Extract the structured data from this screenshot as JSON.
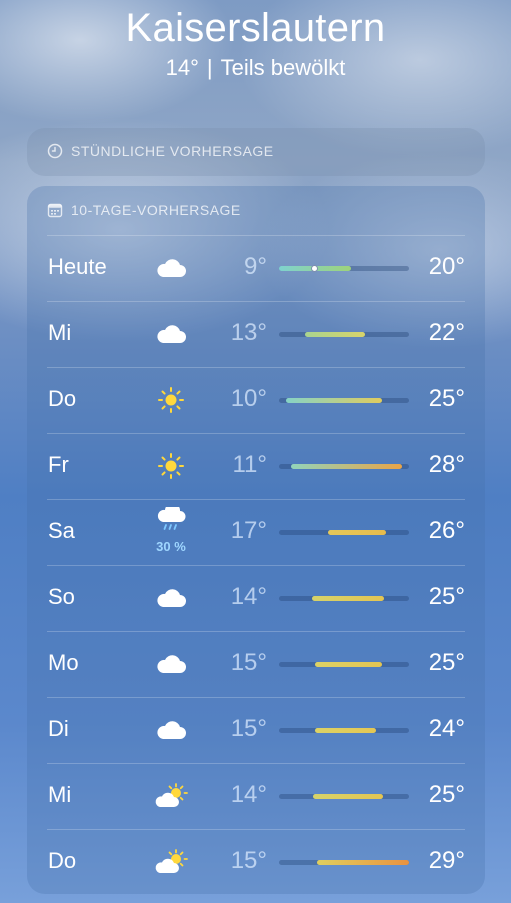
{
  "header": {
    "city": "Kaiserslautern",
    "current_temp": "14°",
    "separator": "|",
    "condition": "Teils bewölkt"
  },
  "hourly": {
    "label": "STÜNDLICHE VORHERSAGE",
    "icon": "clock-icon"
  },
  "daily": {
    "label": "10-TAGE-VORHERSAGE",
    "icon": "calendar-icon",
    "days": [
      {
        "day": "Heute",
        "icon": "cloud-icon",
        "low": "9°",
        "high": "20°",
        "bar_start": 0.0,
        "bar_end": 0.55,
        "current_marker": 0.27,
        "colors": [
          "#7fd2cf",
          "#9ed37a"
        ]
      },
      {
        "day": "Mi",
        "icon": "cloud-icon",
        "low": "13°",
        "high": "22°",
        "bar_start": 0.2,
        "bar_end": 0.66,
        "colors": [
          "#a9d48f",
          "#d8d46a"
        ]
      },
      {
        "day": "Do",
        "icon": "sun-icon",
        "low": "10°",
        "high": "25°",
        "bar_start": 0.05,
        "bar_end": 0.79,
        "colors": [
          "#86d3c6",
          "#e0cc5e"
        ]
      },
      {
        "day": "Fr",
        "icon": "sun-icon",
        "low": "11°",
        "high": "28°",
        "bar_start": 0.09,
        "bar_end": 0.95,
        "colors": [
          "#92d4bb",
          "#e9a447"
        ]
      },
      {
        "day": "Sa",
        "icon": "cloud-rain-icon",
        "precip": "30 %",
        "low": "17°",
        "high": "26°",
        "bar_start": 0.38,
        "bar_end": 0.82,
        "colors": [
          "#e5c85a",
          "#e6bb4d"
        ]
      },
      {
        "day": "So",
        "icon": "cloud-icon",
        "low": "14°",
        "high": "25°",
        "bar_start": 0.25,
        "bar_end": 0.81,
        "colors": [
          "#d6d36a",
          "#e4c552"
        ]
      },
      {
        "day": "Mo",
        "icon": "cloud-icon",
        "low": "15°",
        "high": "25°",
        "bar_start": 0.28,
        "bar_end": 0.79,
        "colors": [
          "#dcd266",
          "#e4c552"
        ]
      },
      {
        "day": "Di",
        "icon": "cloud-icon",
        "low": "15°",
        "high": "24°",
        "bar_start": 0.28,
        "bar_end": 0.75,
        "colors": [
          "#dcd266",
          "#e5c753"
        ]
      },
      {
        "day": "Mi",
        "icon": "sun-cloud-icon",
        "low": "14°",
        "high": "25°",
        "bar_start": 0.26,
        "bar_end": 0.8,
        "colors": [
          "#d6d36a",
          "#e4c552"
        ]
      },
      {
        "day": "Do",
        "icon": "sun-cloud-icon",
        "low": "15°",
        "high": "29°",
        "bar_start": 0.29,
        "bar_end": 1.0,
        "colors": [
          "#e0cf5f",
          "#e9923f"
        ]
      }
    ]
  }
}
